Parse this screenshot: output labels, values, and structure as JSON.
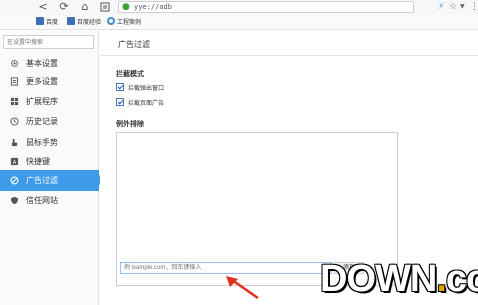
{
  "toolbar": {
    "back_glyph": "<",
    "refresh_glyph": "⟳",
    "home_glyph": "⌂",
    "address": "yye://adb",
    "star_glyph": "☆",
    "menu_glyph": "⋮"
  },
  "bookmarks": [
    {
      "label": "百度"
    },
    {
      "label": "百度经验"
    },
    {
      "label": "工程案例"
    }
  ],
  "sidebar": {
    "search_placeholder": "在设置中搜索",
    "items": [
      {
        "label": "基本设置",
        "icon": "gear-icon"
      },
      {
        "label": "更多设置",
        "icon": "document-icon"
      },
      {
        "label": "扩展程序",
        "icon": "grid-icon"
      },
      {
        "label": "历史记录",
        "icon": "clock-icon"
      },
      {
        "label": "鼠标手势",
        "icon": "hand-icon"
      },
      {
        "label": "快捷键",
        "icon": "keyboard-icon"
      },
      {
        "label": "广告过滤",
        "icon": "block-icon",
        "active": true
      },
      {
        "label": "信任网站",
        "icon": "shield-icon"
      }
    ]
  },
  "content": {
    "title": "广告过滤",
    "block_section": "拦截模式",
    "block_popup": "拦截弹出窗口",
    "block_page_ads": "拦截页面广告",
    "exception_section": "例外排除",
    "exception_placeholder": "例 lxample.com，回车键输入",
    "add_label": "添加"
  },
  "watermark": {
    "prefix": "DOWN",
    "dot": ".",
    "suffix": "cc"
  },
  "colors": {
    "accent": "#3d9be9",
    "arrow": "#e0301e",
    "watermark_accent": "#e8a200"
  }
}
